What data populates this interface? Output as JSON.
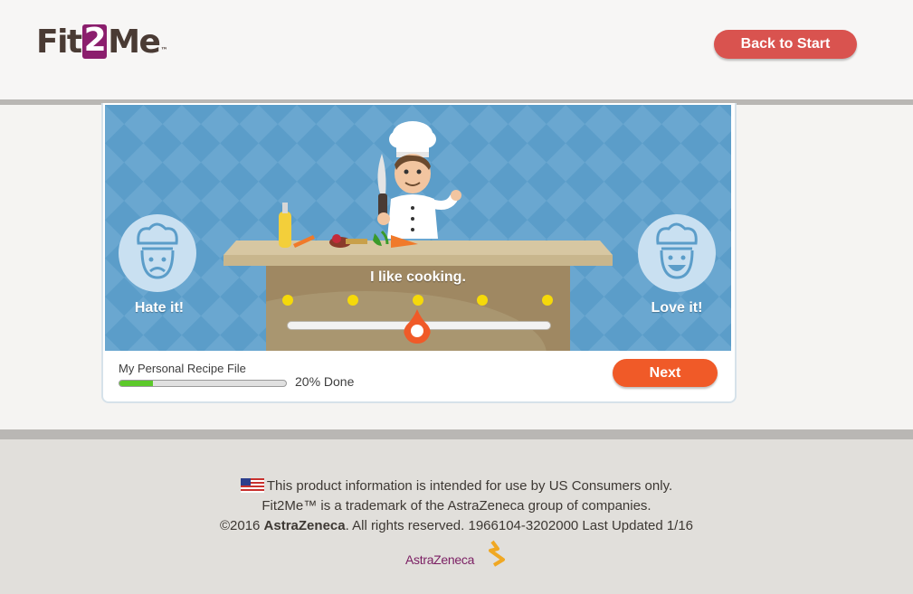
{
  "header": {
    "logo": {
      "part1": "Fit",
      "part2": "2",
      "part3": "Me",
      "tm": "™"
    },
    "back_button": "Back to Start"
  },
  "stage": {
    "left_label": "Hate it!",
    "right_label": "Love it!",
    "prompt": "I like cooking.",
    "scale_points": 5,
    "selected_point": 3
  },
  "progress": {
    "label": "My Personal Recipe File",
    "percent": 20,
    "text": "20% Done"
  },
  "next_button": "Next",
  "footer": {
    "line1": "This product information is intended for use by US Consumers only.",
    "line2": "Fit2Me™ is a trademark of the AstraZeneca group of companies.",
    "line3_prefix": "©2016 ",
    "line3_brand": "AstraZeneca",
    "line3_suffix": ". All rights reserved. 1966104-3202000 Last Updated 1/16",
    "brand_logo": "AstraZeneca"
  },
  "colors": {
    "back_button": "#d9534f",
    "next_button": "#f05a28",
    "stage_bg": "#5b9dc9",
    "progress_fill": "#5cc92a",
    "logo_accent": "#8b1e6d"
  }
}
